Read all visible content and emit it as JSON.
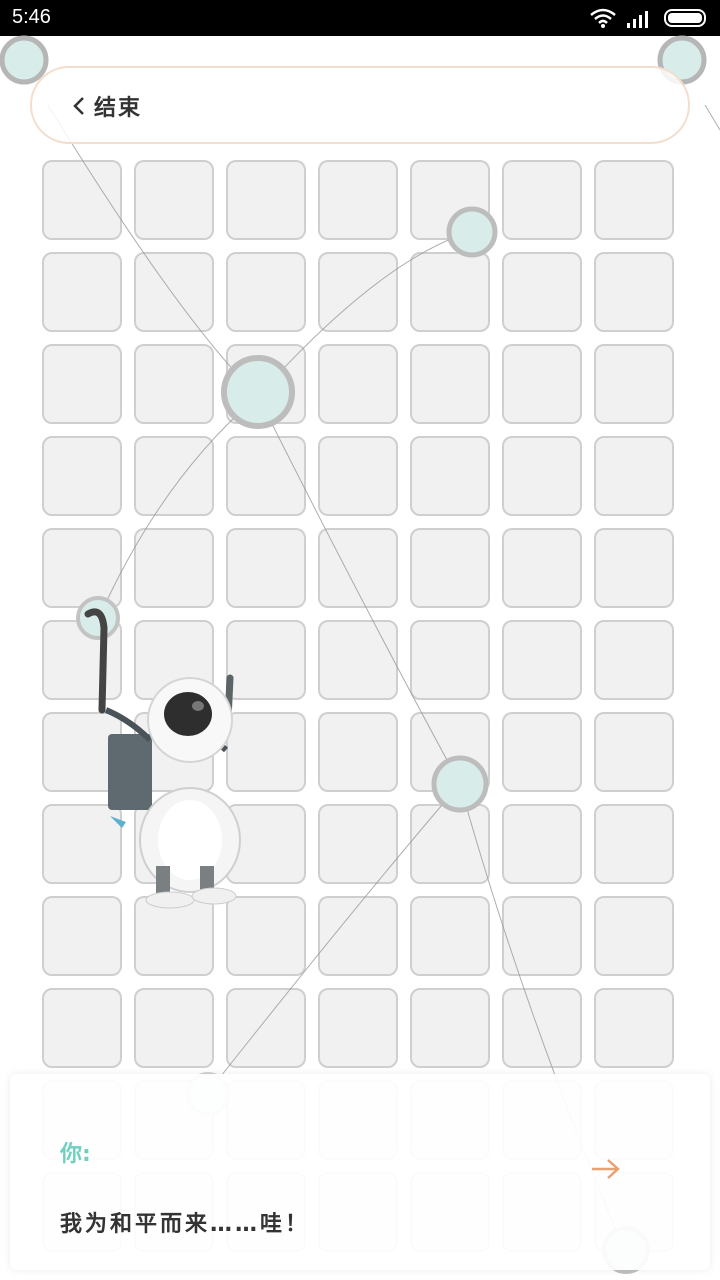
{
  "status_bar": {
    "time": "5:46"
  },
  "header": {
    "back_label": "结束"
  },
  "dialog": {
    "speaker": "你:",
    "message": "我为和平而来……哇！"
  },
  "icons": [
    "wifi-icon",
    "signal-icon",
    "battery-icon",
    "back-chevron-icon",
    "next-arrow-icon",
    "astronaut-figure"
  ],
  "colors": {
    "accent_teal": "#6fd0bf",
    "arrow_orange": "#e6a273",
    "header_border": "#f4ddcb"
  },
  "grid": {
    "rows": 12,
    "cols": 7
  }
}
